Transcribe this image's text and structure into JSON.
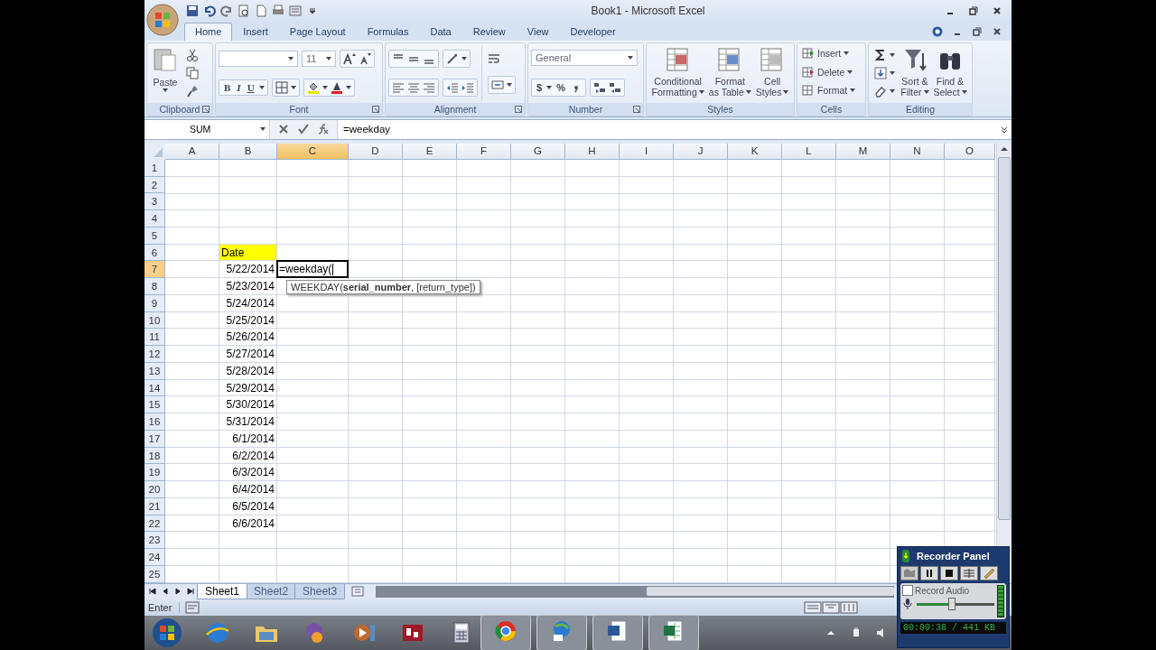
{
  "window": {
    "title": "Book1 - Microsoft Excel"
  },
  "ribbon_tabs": [
    {
      "label": "Home",
      "selected": true
    },
    {
      "label": "Insert",
      "selected": false
    },
    {
      "label": "Page Layout",
      "selected": false
    },
    {
      "label": "Formulas",
      "selected": false
    },
    {
      "label": "Data",
      "selected": false
    },
    {
      "label": "Review",
      "selected": false
    },
    {
      "label": "View",
      "selected": false
    },
    {
      "label": "Developer",
      "selected": false
    }
  ],
  "ribbon": {
    "clipboard": {
      "paste": "Paste",
      "label": "Clipboard"
    },
    "font": {
      "size": "11",
      "style_buttons": [
        "B",
        "I",
        "U"
      ],
      "label": "Font"
    },
    "alignment": {
      "label": "Alignment"
    },
    "number": {
      "format": "General",
      "symbols": [
        "$",
        "%"
      ],
      "label": "Number"
    },
    "styles": {
      "buttons": [
        {
          "lines": [
            "Conditional",
            "Formatting"
          ]
        },
        {
          "lines": [
            "Format",
            "as Table"
          ]
        },
        {
          "lines": [
            "Cell",
            "Styles"
          ]
        }
      ],
      "label": "Styles"
    },
    "cells": {
      "buttons": [
        "Insert",
        "Delete",
        "Format"
      ],
      "label": "Cells"
    },
    "editing": {
      "buttons": [
        {
          "lines": [
            "Sort &",
            "Filter"
          ]
        },
        {
          "lines": [
            "Find &",
            "Select"
          ]
        }
      ],
      "label": "Editing"
    }
  },
  "formula_bar": {
    "name_box": "SUM",
    "formula": "=weekday"
  },
  "columns": [
    {
      "label": "A",
      "selected": false
    },
    {
      "label": "B",
      "selected": false
    },
    {
      "label": "C",
      "selected": true
    },
    {
      "label": "D",
      "selected": false
    },
    {
      "label": "E",
      "selected": false
    },
    {
      "label": "F",
      "selected": false
    },
    {
      "label": "G",
      "selected": false
    },
    {
      "label": "H",
      "selected": false
    },
    {
      "label": "I",
      "selected": false
    },
    {
      "label": "J",
      "selected": false
    },
    {
      "label": "K",
      "selected": false
    },
    {
      "label": "L",
      "selected": false
    },
    {
      "label": "M",
      "selected": false
    },
    {
      "label": "N",
      "selected": false
    },
    {
      "label": "O",
      "selected": false
    }
  ],
  "rows": [
    {
      "number": "1",
      "selected": false
    },
    {
      "number": "2",
      "selected": false
    },
    {
      "number": "3",
      "selected": false
    },
    {
      "number": "4",
      "selected": false
    },
    {
      "number": "5",
      "selected": false
    },
    {
      "number": "6",
      "selected": false,
      "b": {
        "text": "Date",
        "kind": "text",
        "fill": true
      }
    },
    {
      "number": "7",
      "selected": true,
      "b": {
        "text": "5/22/2014",
        "kind": "number",
        "fill": false
      },
      "c": {
        "text": "=weekday(",
        "active": true
      }
    },
    {
      "number": "8",
      "selected": false,
      "b": {
        "text": "5/23/2014",
        "kind": "number",
        "fill": false
      }
    },
    {
      "number": "9",
      "selected": false,
      "b": {
        "text": "5/24/2014",
        "kind": "number",
        "fill": false
      }
    },
    {
      "number": "10",
      "selected": false,
      "b": {
        "text": "5/25/2014",
        "kind": "number",
        "fill": false
      }
    },
    {
      "number": "11",
      "selected": false,
      "b": {
        "text": "5/26/2014",
        "kind": "number",
        "fill": false
      }
    },
    {
      "number": "12",
      "selected": false,
      "b": {
        "text": "5/27/2014",
        "kind": "number",
        "fill": false
      }
    },
    {
      "number": "13",
      "selected": false,
      "b": {
        "text": "5/28/2014",
        "kind": "number",
        "fill": false
      }
    },
    {
      "number": "14",
      "selected": false,
      "b": {
        "text": "5/29/2014",
        "kind": "number",
        "fill": false
      }
    },
    {
      "number": "15",
      "selected": false,
      "b": {
        "text": "5/30/2014",
        "kind": "number",
        "fill": false
      }
    },
    {
      "number": "16",
      "selected": false,
      "b": {
        "text": "5/31/2014",
        "kind": "number",
        "fill": false
      }
    },
    {
      "number": "17",
      "selected": false,
      "b": {
        "text": "6/1/2014",
        "kind": "number",
        "fill": false
      }
    },
    {
      "number": "18",
      "selected": false,
      "b": {
        "text": "6/2/2014",
        "kind": "number",
        "fill": false
      }
    },
    {
      "number": "19",
      "selected": false,
      "b": {
        "text": "6/3/2014",
        "kind": "number",
        "fill": false
      }
    },
    {
      "number": "20",
      "selected": false,
      "b": {
        "text": "6/4/2014",
        "kind": "number",
        "fill": false
      }
    },
    {
      "number": "21",
      "selected": false,
      "b": {
        "text": "6/5/2014",
        "kind": "number",
        "fill": false
      }
    },
    {
      "number": "22",
      "selected": false,
      "b": {
        "text": "6/6/2014",
        "kind": "number",
        "fill": false
      }
    },
    {
      "number": "23",
      "selected": false
    },
    {
      "number": "24",
      "selected": false
    },
    {
      "number": "25",
      "selected": false
    }
  ],
  "tooltip": "WEEKDAY(**serial_number**, [return_type])",
  "sheet_tabs": [
    {
      "label": "Sheet1",
      "selected": true
    },
    {
      "label": "Sheet2",
      "selected": false
    },
    {
      "label": "Sheet3",
      "selected": false
    }
  ],
  "status_bar": {
    "mode": "Enter"
  },
  "recorder_panel": {
    "title": "Recorder Panel",
    "record_audio": {
      "label": "Record Audio",
      "checked": false
    },
    "volume": {
      "level": 0.45
    },
    "timer": "00:00:38 / 441 KB"
  }
}
